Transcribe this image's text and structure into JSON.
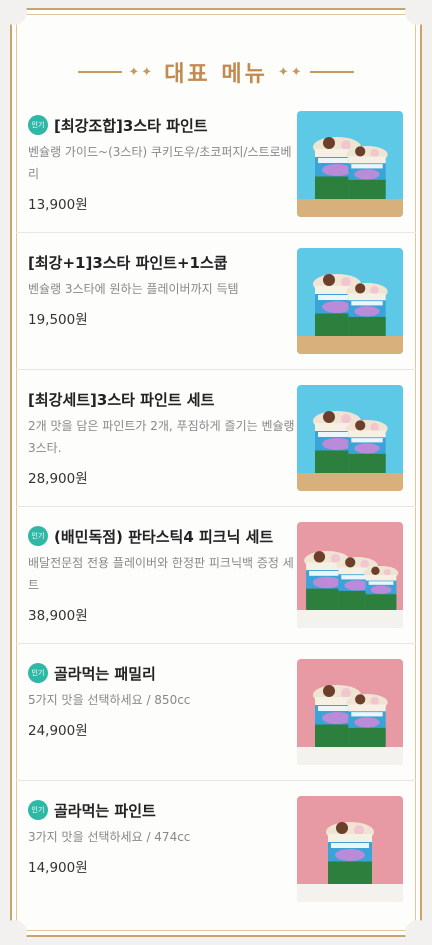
{
  "header": {
    "title": "대표 메뉴",
    "deco_left": "✦✦",
    "deco_right": "✦✦"
  },
  "items": [
    {
      "popular": true,
      "badge": "인기",
      "name": "[최강조합]3스타 파인트",
      "desc": "벤슐랭 가이드~(3스타) 쿠키도우/초코퍼지/스트로베리",
      "price": "13,900원",
      "image": {
        "bg": "#5ec9e6",
        "floor": "#d7b07b",
        "cups": 2,
        "cup_label": "Fresh Packed"
      }
    },
    {
      "popular": false,
      "badge": "",
      "name": "[최강+1]3스타 파인트+1스쿱",
      "desc": "벤슐랭 3스타에 원하는 플레이버까지 득템",
      "price": "19,500원",
      "image": {
        "bg": "#5ec9e6",
        "floor": "#d7b07b",
        "cups": 2,
        "cup_label": "Fresh Packed"
      }
    },
    {
      "popular": false,
      "badge": "",
      "name": "[최강세트]3스타 파인트 세트",
      "desc": "2개 맛을 담은 파인트가 2개, 푸짐하게 즐기는 벤슐랭 3스타.",
      "price": "28,900원",
      "image": {
        "bg": "#5ec9e6",
        "floor": "#d7b07b",
        "cups": 2,
        "cup_label": "Fresh Packed"
      }
    },
    {
      "popular": true,
      "badge": "인기",
      "name": "(배민독점) 판타스틱4 피크닉 세트",
      "desc": "배달전문점 전용 플레이버와 한정판 피크닉백 증정 세트",
      "price": "38,900원",
      "image": {
        "bg": "#e79aa3",
        "floor": "#f4f2ef",
        "cups": 3,
        "cup_label": "Fresh Packed"
      }
    },
    {
      "popular": true,
      "badge": "인기",
      "name": "골라먹는 패밀리",
      "desc": "5가지 맛을 선택하세요 / 850cc",
      "price": "24,900원",
      "image": {
        "bg": "#e79aa3",
        "floor": "#f4f2ef",
        "cups": 2,
        "cup_label": "Fresh Packed"
      }
    },
    {
      "popular": true,
      "badge": "인기",
      "name": "골라먹는 파인트",
      "desc": "3가지 맛을 선택하세요 / 474cc",
      "price": "14,900원",
      "image": {
        "bg": "#e79aa3",
        "floor": "#f4f2ef",
        "cups": 1,
        "cup_label": "Fresh Packed"
      }
    }
  ]
}
